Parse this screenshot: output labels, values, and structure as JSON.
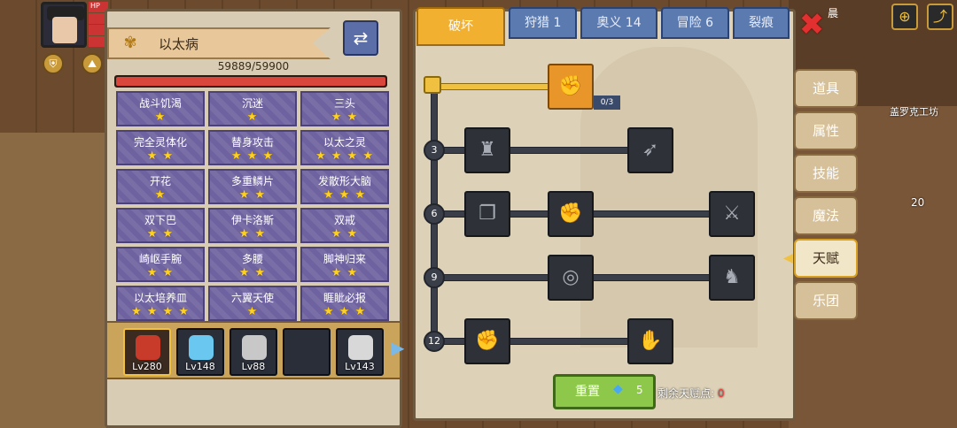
{
  "player": {
    "hp_label": "HP"
  },
  "hero": {
    "name": "以太病",
    "hp_text": "59889/59900",
    "hp_fraction": 0.9998
  },
  "traits": [
    {
      "name": "战斗饥渴",
      "stars": "★"
    },
    {
      "name": "沉迷",
      "stars": "★"
    },
    {
      "name": "三头",
      "stars": "★ ★"
    },
    {
      "name": "完全灵体化",
      "stars": "★ ★"
    },
    {
      "name": "替身攻击",
      "stars": "★ ★ ★"
    },
    {
      "name": "以太之灵",
      "stars": "★ ★ ★ ★"
    },
    {
      "name": "开花",
      "stars": "★"
    },
    {
      "name": "多重鳞片",
      "stars": "★ ★"
    },
    {
      "name": "发散形大脑",
      "stars": "★ ★ ★"
    },
    {
      "name": "双下巴",
      "stars": "★ ★"
    },
    {
      "name": "伊卡洛斯",
      "stars": "★ ★"
    },
    {
      "name": "双戒",
      "stars": "★ ★"
    },
    {
      "name": "崎岖手腕",
      "stars": "★ ★"
    },
    {
      "name": "多腰",
      "stars": "★ ★"
    },
    {
      "name": "脚神归来",
      "stars": "★ ★"
    },
    {
      "name": "以太培养皿",
      "stars": "★ ★ ★ ★"
    },
    {
      "name": "六翼天使",
      "stars": "★"
    },
    {
      "name": "睚眦必报",
      "stars": "★ ★ ★"
    }
  ],
  "party": [
    {
      "level": "Lv280",
      "color": "#c83a2a"
    },
    {
      "level": "Lv148",
      "color": "#6ac8f0"
    },
    {
      "level": "Lv88",
      "color": "#c8c8c8"
    },
    {
      "level": "",
      "color": "#2a2e38"
    },
    {
      "level": "Lv143",
      "color": "#d8d8d8"
    }
  ],
  "tabs": [
    "破坏",
    "狩猎 1",
    "奥义 14",
    "冒险 6",
    "裂痕"
  ],
  "tree": {
    "top_node_count": "0/3",
    "levels": [
      "3",
      "6",
      "9",
      "12"
    ]
  },
  "reset": {
    "label": "重置",
    "cost": "5",
    "remaining_label": "剩余天赋点: ",
    "remaining_value": "0"
  },
  "side_menu": [
    "道具",
    "属性",
    "技能",
    "魔法",
    "天赋",
    "乐团"
  ],
  "world": {
    "npc_name": "盖罗克工坊",
    "item_count": "20",
    "top_text": "晨"
  },
  "icons": {
    "close": "close-icon",
    "swap": "swap-icon",
    "gem": "gem-icon",
    "arm_wrestle": "arm-wrestle-icon",
    "muscle": "muscle-icon",
    "arrow_hit": "arrow-hit-icon",
    "scroll": "scroll-icon",
    "fist_punch": "fist-punch-icon",
    "sword_strike": "sword-strike-icon",
    "ripple": "ripple-icon",
    "bat": "bat-icon",
    "raised_fist": "raised-fist-icon",
    "bandaged_fist": "bandaged-fist-icon"
  },
  "colors": {
    "active_tab": "#f2b030",
    "tab": "#5b7bb0",
    "hp": "#d8463c",
    "star": "#ffd21c",
    "reset": "#8ec84a"
  }
}
